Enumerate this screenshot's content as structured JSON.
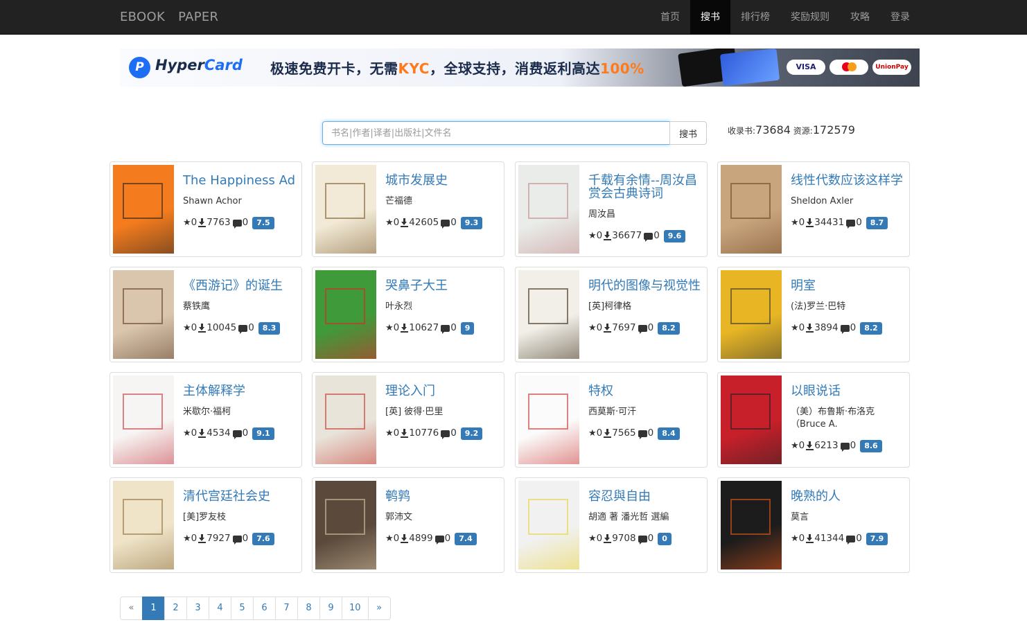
{
  "nav": {
    "brand": [
      "EBOOK",
      "PAPER"
    ],
    "items": [
      "首页",
      "搜书",
      "排行榜",
      "奖励规则",
      "攻略",
      "登录"
    ],
    "active_index": 1
  },
  "banner": {
    "brand_part1": "Hyper",
    "brand_part2": "Card",
    "slogan_a": "极速免费开卡，无需",
    "slogan_kyc": "KYC",
    "slogan_b": "，全球支持，消费返利高达",
    "slogan_pct": "100%",
    "pay_visa": "VISA",
    "pay_unionpay": "UnionPay"
  },
  "search": {
    "placeholder": "书名|作者|译者|出版社|文件名",
    "button": "搜书",
    "books_label": "收录书:",
    "books_count": "73684",
    "resources_label": "资源:",
    "resources_count": "172579"
  },
  "books": [
    {
      "title": "The Happiness Ad",
      "author": "Shawn Achor",
      "stars": "0",
      "downloads": "7763",
      "comments": "0",
      "score": "7.5",
      "cover_bg": "#f57c1e",
      "cover_fg": "#222"
    },
    {
      "title": "城市发展史",
      "author": "芒福德",
      "stars": "0",
      "downloads": "42605",
      "comments": "0",
      "score": "9.3",
      "cover_bg": "#f2ead6",
      "cover_fg": "#7a5a2e"
    },
    {
      "title": "千载有余情--周汝昌赏会古典诗词",
      "author": "周汝昌",
      "stars": "0",
      "downloads": "36677",
      "comments": "0",
      "score": "9.6",
      "cover_bg": "#e9ece9",
      "cover_fg": "#c28a8a"
    },
    {
      "title": "线性代数应该这样学",
      "author": "Sheldon Axler",
      "stars": "0",
      "downloads": "34431",
      "comments": "0",
      "score": "8.7",
      "cover_bg": "#c9a57e",
      "cover_fg": "#6b4421"
    },
    {
      "title": "《西游记》的诞生",
      "author": "蔡铁鹰",
      "stars": "0",
      "downloads": "10045",
      "comments": "0",
      "score": "8.3",
      "cover_bg": "#d9c6ad",
      "cover_fg": "#5b3b23"
    },
    {
      "title": "哭鼻子大王",
      "author": "叶永烈",
      "stars": "0",
      "downloads": "10627",
      "comments": "0",
      "score": "9",
      "cover_bg": "#3f9a3a",
      "cover_fg": "#e6212a"
    },
    {
      "title": "明代的图像与视觉性",
      "author": "[英]柯律格",
      "stars": "0",
      "downloads": "7697",
      "comments": "0",
      "score": "8.2",
      "cover_bg": "#f1efe8",
      "cover_fg": "#3a2a14"
    },
    {
      "title": "明室",
      "author": "(法)罗兰·巴特",
      "stars": "0",
      "downloads": "3894",
      "comments": "0",
      "score": "8.2",
      "cover_bg": "#e8b624",
      "cover_fg": "#333"
    },
    {
      "title": "主体解释学",
      "author": "米歇尔·福柯",
      "stars": "0",
      "downloads": "4534",
      "comments": "0",
      "score": "9.1",
      "cover_bg": "#f7f5f3",
      "cover_fg": "#c4343f"
    },
    {
      "title": "理论入门",
      "author": "[英] 彼得·巴里",
      "stars": "0",
      "downloads": "10776",
      "comments": "0",
      "score": "9.2",
      "cover_bg": "#e9e4da",
      "cover_fg": "#c4322b"
    },
    {
      "title": "特权",
      "author": "西莫斯·可汗",
      "stars": "0",
      "downloads": "7565",
      "comments": "0",
      "score": "8.4",
      "cover_bg": "#fbfbfb",
      "cover_fg": "#c9312c"
    },
    {
      "title": "以眼说话",
      "author": "（美）布鲁斯·布洛克（Bruce A.",
      "stars": "0",
      "downloads": "6213",
      "comments": "0",
      "score": "8.6",
      "cover_bg": "#c8202a",
      "cover_fg": "#222"
    },
    {
      "title": "清代宫廷社会史",
      "author": "[美]罗友枝",
      "stars": "0",
      "downloads": "7927",
      "comments": "0",
      "score": "7.6",
      "cover_bg": "#efe4c8",
      "cover_fg": "#8d6e3d"
    },
    {
      "title": "鹌鹑",
      "author": "郭沛文",
      "stars": "0",
      "downloads": "4899",
      "comments": "0",
      "score": "7.4",
      "cover_bg": "#5b4a3c",
      "cover_fg": "#d8c4a5"
    },
    {
      "title": "容忍與自由",
      "author": "胡適 著 潘光哲 選編",
      "stars": "0",
      "downloads": "9708",
      "comments": "0",
      "score": "0",
      "cover_bg": "#f1f1f1",
      "cover_fg": "#e8d33a"
    },
    {
      "title": "晚熟的人",
      "author": "莫言",
      "stars": "0",
      "downloads": "41344",
      "comments": "0",
      "score": "7.9",
      "cover_bg": "#1c1c1c",
      "cover_fg": "#ea5a1d"
    }
  ],
  "pagination": {
    "prev": "«",
    "pages": [
      "1",
      "2",
      "3",
      "4",
      "5",
      "6",
      "7",
      "8",
      "9",
      "10"
    ],
    "next": "»",
    "active_index": 0
  }
}
